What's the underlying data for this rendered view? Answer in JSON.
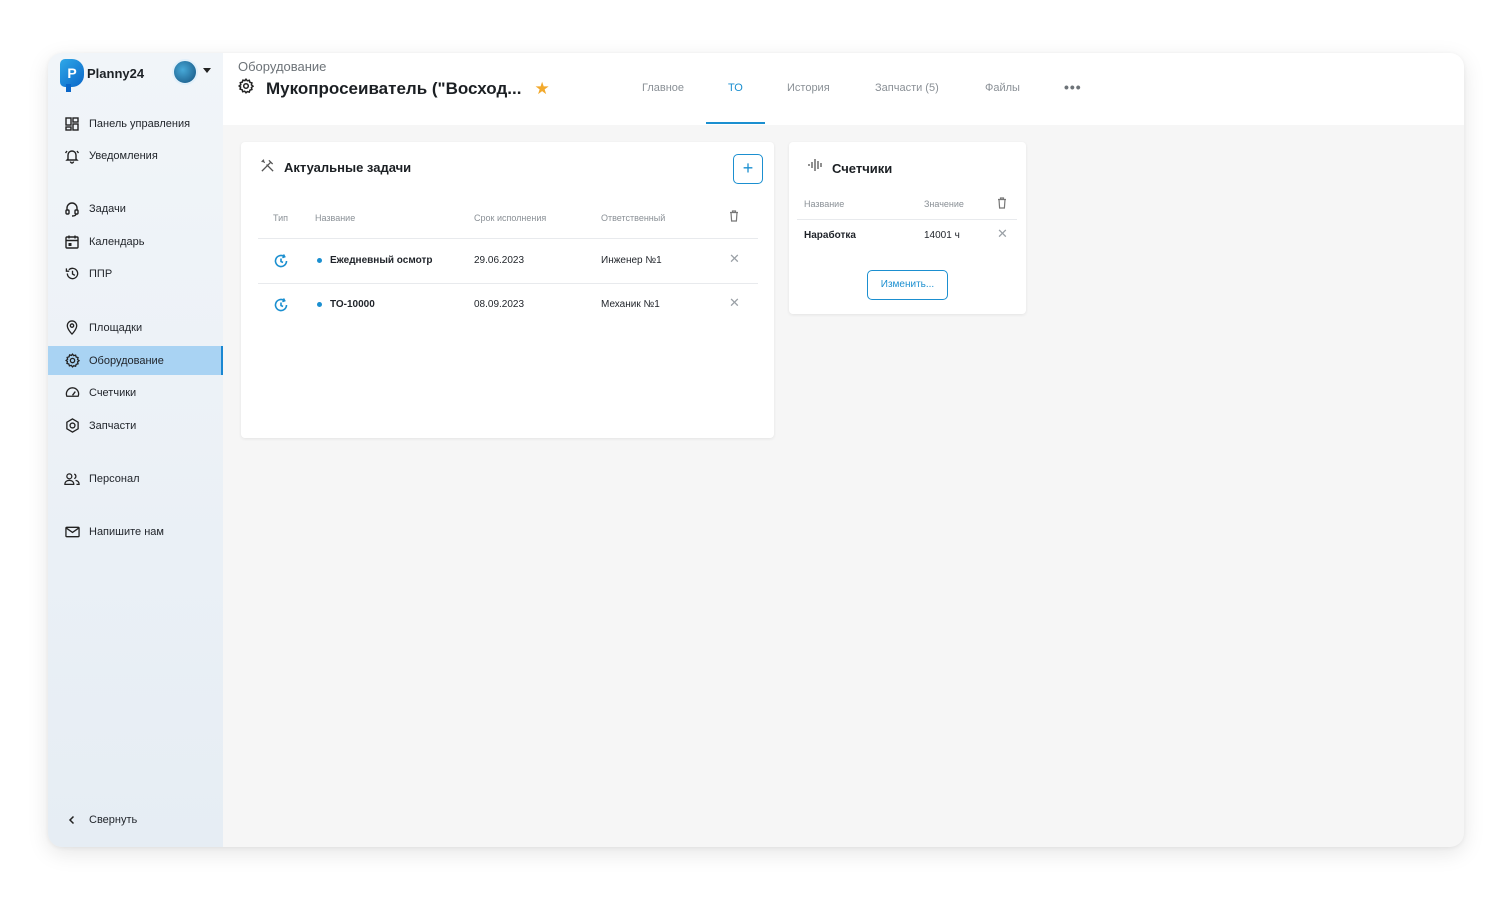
{
  "app": {
    "name": "Planny24"
  },
  "sidebar": {
    "items": [
      {
        "label": "Панель управления",
        "icon": "dashboard-icon"
      },
      {
        "label": "Уведомления",
        "icon": "bell-icon"
      },
      {
        "label": "Задачи",
        "icon": "headset-icon"
      },
      {
        "label": "Календарь",
        "icon": "calendar-icon"
      },
      {
        "label": "ППР",
        "icon": "history-icon"
      },
      {
        "label": "Площадки",
        "icon": "location-pin-icon"
      },
      {
        "label": "Оборудование",
        "icon": "gear-icon",
        "active": true
      },
      {
        "label": "Счетчики",
        "icon": "speedometer-icon"
      },
      {
        "label": "Запчасти",
        "icon": "hexagon-icon"
      },
      {
        "label": "Персонал",
        "icon": "people-icon"
      },
      {
        "label": "Напишите нам",
        "icon": "mail-icon"
      }
    ],
    "collapse_label": "Свернуть"
  },
  "header": {
    "breadcrumb": "Оборудование",
    "title": "Мукопросеиватель (\"Восход...",
    "tabs": [
      {
        "label": "Главное"
      },
      {
        "label": "ТО",
        "active": true
      },
      {
        "label": "История"
      },
      {
        "label": "Запчасти (5)"
      },
      {
        "label": "Файлы"
      }
    ],
    "more": "•••"
  },
  "tasks_card": {
    "title": "Актуальные задачи",
    "add_label": "+",
    "columns": [
      "Тип",
      "Название",
      "Срок исполнения",
      "Ответственный"
    ],
    "rows": [
      {
        "name": "Ежедневный осмотр",
        "due": "29.06.2023",
        "responsible": "Инженер №1"
      },
      {
        "name": "ТО-10000",
        "due": "08.09.2023",
        "responsible": "Механик №1"
      }
    ]
  },
  "counters_card": {
    "title": "Счетчики",
    "columns": [
      "Название",
      "Значение"
    ],
    "rows": [
      {
        "name": "Наработка",
        "value": "14001 ч"
      }
    ],
    "edit_label": "Изменить..."
  },
  "colors": {
    "accent": "#1b8fd0",
    "active_nav": "#a9d3f3",
    "star": "#f2a92c"
  }
}
